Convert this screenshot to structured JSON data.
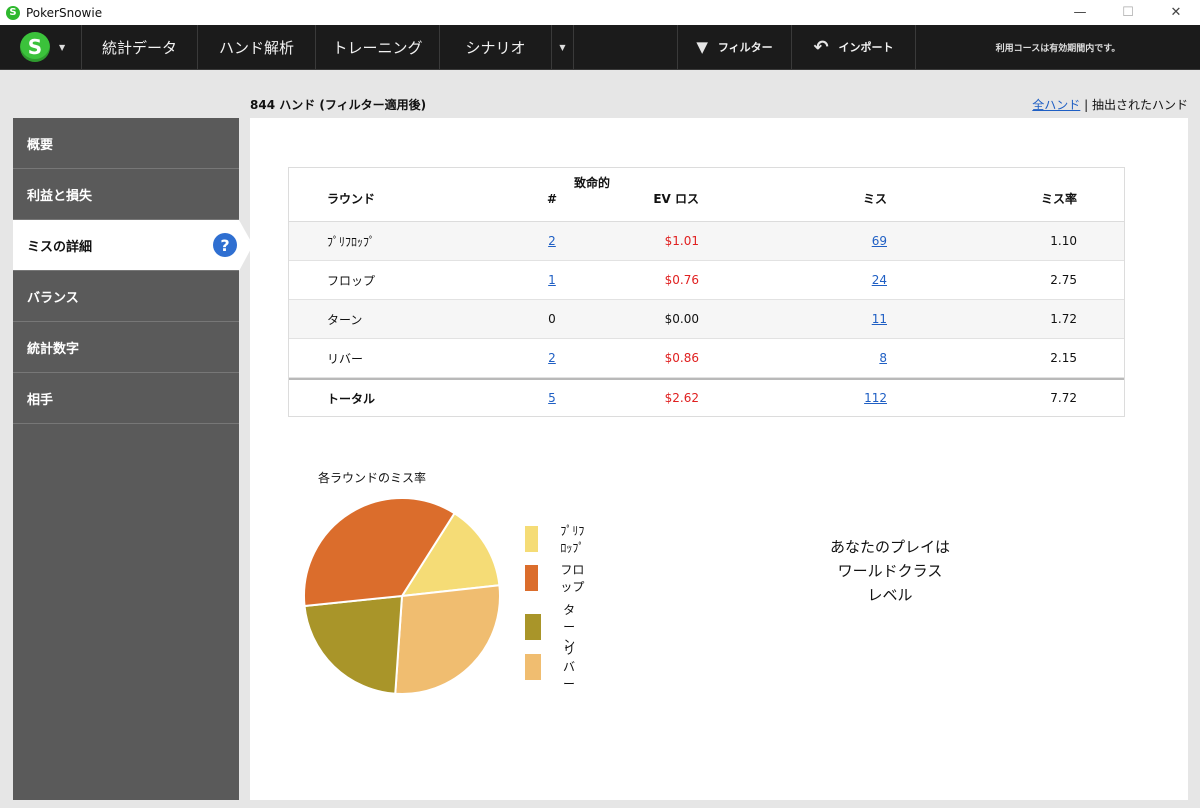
{
  "window": {
    "title": "PokerSnowie",
    "minimize": "—",
    "maximize": "☐",
    "close": "✕"
  },
  "toolbar": {
    "logo": "S",
    "nav": [
      "統計データ",
      "ハンド解析",
      "トレーニング",
      "シナリオ"
    ],
    "filter_label": "フィルター",
    "import_label": "インポート",
    "info": "利用コースは有効期間内です。"
  },
  "header": {
    "hand_count": "844 ハンド (フィルター適用後)",
    "all_hands": "全ハンド",
    "separator": " | ",
    "extracted_hands": "抽出されたハンド"
  },
  "sidebar": {
    "items": [
      {
        "label": "概要",
        "active": false
      },
      {
        "label": "利益と損失",
        "active": false
      },
      {
        "label": "ミスの詳細",
        "active": true
      },
      {
        "label": "バランス",
        "active": false
      },
      {
        "label": "統計数字",
        "active": false
      },
      {
        "label": "相手",
        "active": false
      }
    ],
    "help": "?"
  },
  "table": {
    "headers": {
      "round": "ラウンド",
      "fatal_top": "致命的",
      "fatal": "#",
      "ev": "EV ロス",
      "miss": "ミス",
      "rate": "ミス率"
    },
    "rows": [
      {
        "round": "ﾌﾟﾘﾌﾛｯﾌﾟ",
        "fatal": "2",
        "ev": "$1.01",
        "miss": "69",
        "rate": "1.10"
      },
      {
        "round": "フロップ",
        "fatal": "1",
        "ev": "$0.76",
        "miss": "24",
        "rate": "2.75"
      },
      {
        "round": "ターン",
        "fatal": "0",
        "ev": "$0.00",
        "miss": "11",
        "rate": "1.72"
      },
      {
        "round": "リバー",
        "fatal": "2",
        "ev": "$0.86",
        "miss": "8",
        "rate": "2.15"
      }
    ],
    "total": {
      "round": "トータル",
      "fatal": "5",
      "ev": "$2.62",
      "miss": "112",
      "rate": "7.72"
    }
  },
  "chart_data": {
    "type": "pie",
    "title": "各ラウンドのミス率",
    "categories": [
      "ﾌﾟﾘﾌﾛｯﾌﾟ",
      "フロップ",
      "ターン",
      "リバー"
    ],
    "values": [
      1.1,
      2.75,
      1.72,
      2.15
    ],
    "colors": [
      "#f5dc76",
      "#db6d2c",
      "#a99529",
      "#f0bd70"
    ],
    "legend": "right"
  },
  "level": {
    "line1": "あなたのプレイは",
    "line2": "ワールドクラス",
    "line3": "レベル"
  }
}
